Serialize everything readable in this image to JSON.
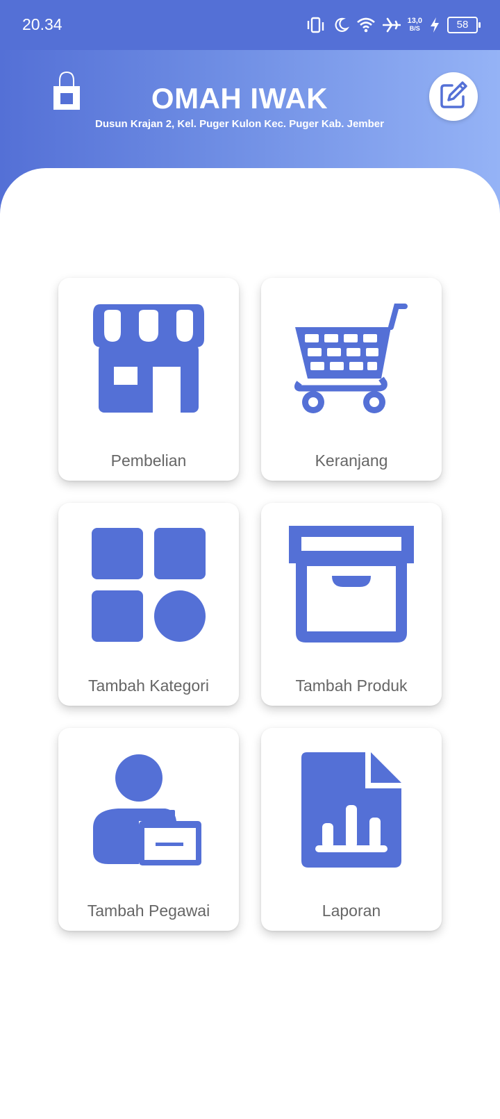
{
  "status_bar": {
    "time": "20.34",
    "net_speed_value": "13,0",
    "net_speed_unit": "B/S",
    "battery": "58"
  },
  "header": {
    "title": "OMAH IWAK",
    "address": "Dusun Krajan 2, Kel. Puger Kulon Kec. Puger Kab. Jember",
    "logo_icon": "shopping-bag-icon",
    "edit_icon": "edit-icon"
  },
  "menu": {
    "items": [
      {
        "label": "Pembelian",
        "icon": "storefront-icon"
      },
      {
        "label": "Keranjang",
        "icon": "cart-icon"
      },
      {
        "label": "Tambah Kategori",
        "icon": "category-icon"
      },
      {
        "label": "Tambah Produk",
        "icon": "archive-box-icon"
      },
      {
        "label": "Tambah Pegawai",
        "icon": "employee-badge-icon"
      },
      {
        "label": "Laporan",
        "icon": "report-icon"
      }
    ]
  },
  "colors": {
    "accent": "#5470d6",
    "gradient_end": "#95b3f6",
    "card_label": "#666666"
  }
}
